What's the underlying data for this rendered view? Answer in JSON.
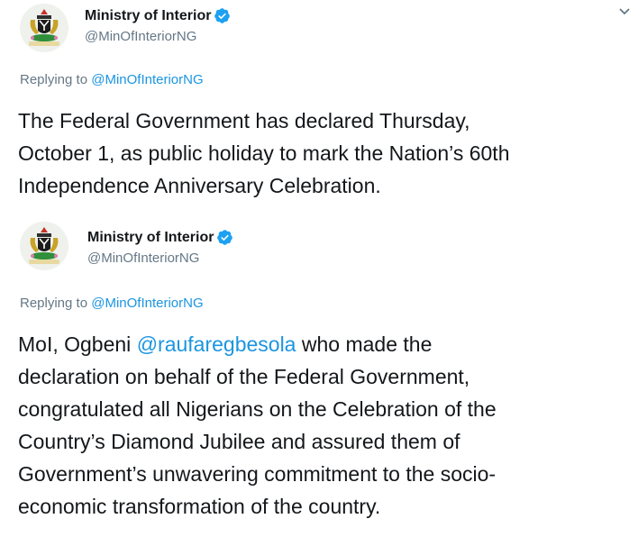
{
  "tweets": [
    {
      "author": {
        "name": "Ministry of Interior",
        "handle": "@MinOfInteriorNG",
        "verified": true
      },
      "reply": {
        "prefix": "Replying to",
        "mention": "@MinOfInteriorNG"
      },
      "text_lines": [
        "The Federal Government has declared Thursday,",
        "October 1, as public holiday to mark the Nation’s 60th",
        "Independence Anniversary Celebration."
      ]
    },
    {
      "author": {
        "name": "Ministry of Interior",
        "handle": "@MinOfInteriorNG",
        "verified": true
      },
      "reply": {
        "prefix": "Replying to",
        "mention": "@MinOfInteriorNG"
      },
      "text_first_prefix": "MoI, Ogbeni ",
      "text_first_mention": "@raufaregbesola",
      "text_first_suffix": " who made the",
      "text_lines": [
        "declaration on behalf of the Federal Government,",
        "congratulated all Nigerians on the Celebration of the",
        "Country’s Diamond Jubilee and assured them of",
        "Government’s unwavering commitment to the socio-",
        "economic transformation of the country."
      ]
    }
  ],
  "colors": {
    "link": "#1b95e0",
    "muted": "#657786",
    "verified": "#1da1f2",
    "text": "#14171a"
  },
  "icons": {
    "avatar": "nigeria-coat-of-arms-icon",
    "verified": "verified-badge-icon",
    "menu": "chevron-down-icon"
  }
}
